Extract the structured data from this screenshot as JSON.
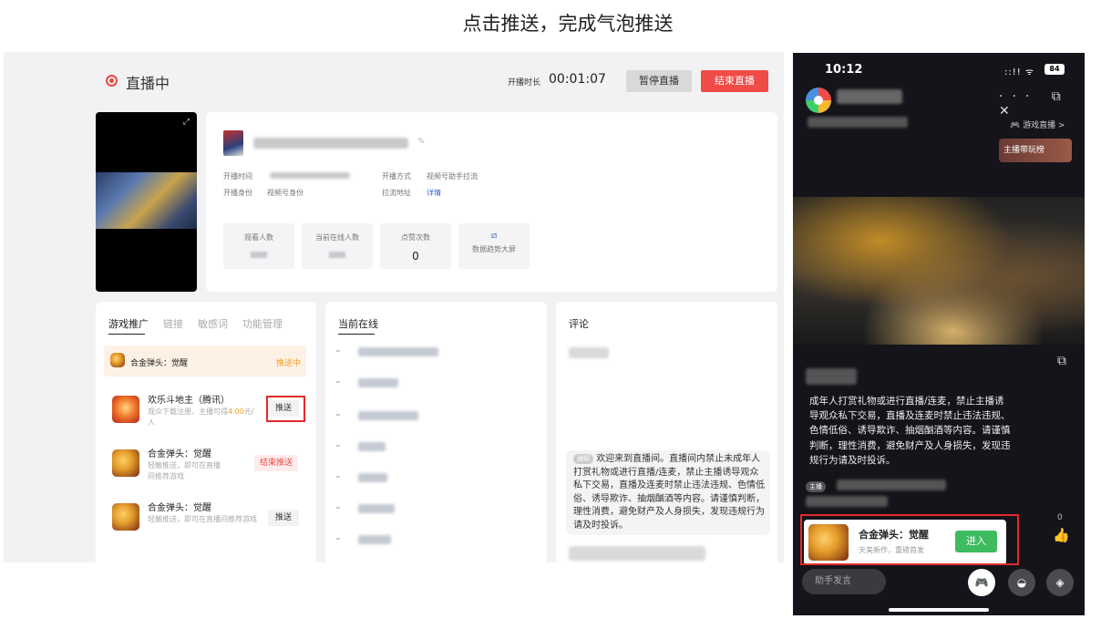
{
  "caption": "点击推送，完成气泡推送",
  "console": {
    "status": "直播中",
    "duration_label": "开播时长",
    "duration": "00:01:07",
    "pause_button": "暂停直播",
    "end_button": "结束直播",
    "info": {
      "start_time_label": "开播时间",
      "identity_label": "开播身份",
      "identity_value": "视频号身份",
      "method_label": "开播方式",
      "method_value": "视频号助手拉流",
      "stream_label": "拉流地址",
      "stream_value": "详情"
    },
    "stats": [
      {
        "label": "观看人数",
        "value": ""
      },
      {
        "label": "当前在线人数",
        "value": ""
      },
      {
        "label": "点赞次数",
        "value": "0"
      }
    ],
    "dashboard_label": "数据趋势大屏",
    "promo_tabs": [
      "游戏推广",
      "链接",
      "敏感词",
      "功能管理"
    ],
    "promo_current": {
      "name": "合金弹头：觉醒",
      "status": "推送中"
    },
    "promo_items": [
      {
        "name": "欢乐斗地主（腾讯）",
        "sub_prefix": "观众下载注册，主播可得",
        "reward": "4.00",
        "sub_suffix": "元/人",
        "action": "推送"
      },
      {
        "name": "合金弹头：觉醒",
        "sub": "轻触推送，即可在直播间推荐游戏",
        "action": "结束推送"
      },
      {
        "name": "合金弹头：觉醒",
        "sub": "轻触推送，即可在直播间推荐游戏",
        "action": "推送"
      }
    ],
    "online_title": "当前在线",
    "comments_title": "评论",
    "notice_tag": "通知",
    "notice": "欢迎来到直播间。直播间内禁止未成年人打赏礼物或进行直播/连麦，禁止主播诱导观众私下交易，直播及连麦时禁止违法违规、色情低俗、诱导欺诈、抽烟酗酒等内容。请谨慎判断，理性消费，避免财产及人身损失，发现违规行为请及时投诉。"
  },
  "phone": {
    "time": "10:12",
    "signal": "::!! ᯤ",
    "battery": "84",
    "top_icons": "··· ⧉ ✕",
    "game_live": "🎮 游戏直播 >",
    "rank_label": "主播带玩榜",
    "rules": "成年人打赏礼物或进行直播/连麦，禁止主播诱导观众私下交易，直播及连麦时禁止违法违规、色情低俗、诱导欺诈、抽烟酗酒等内容。请谨慎判断，理性消费，避免财产及人身损失，发现违规行为请及时投诉。",
    "host_tag": "主播",
    "card": {
      "name": "合金弹头：觉醒",
      "sub": "天美新作，重磅首发",
      "action": "进入"
    },
    "likes": "0",
    "input_placeholder": "助手发言"
  },
  "colors": {
    "accent_red": "#ef4b47",
    "pushing_orange": "#f0a020",
    "enter_green": "#3dbb5e",
    "highlight_box": "#e32a2a"
  }
}
